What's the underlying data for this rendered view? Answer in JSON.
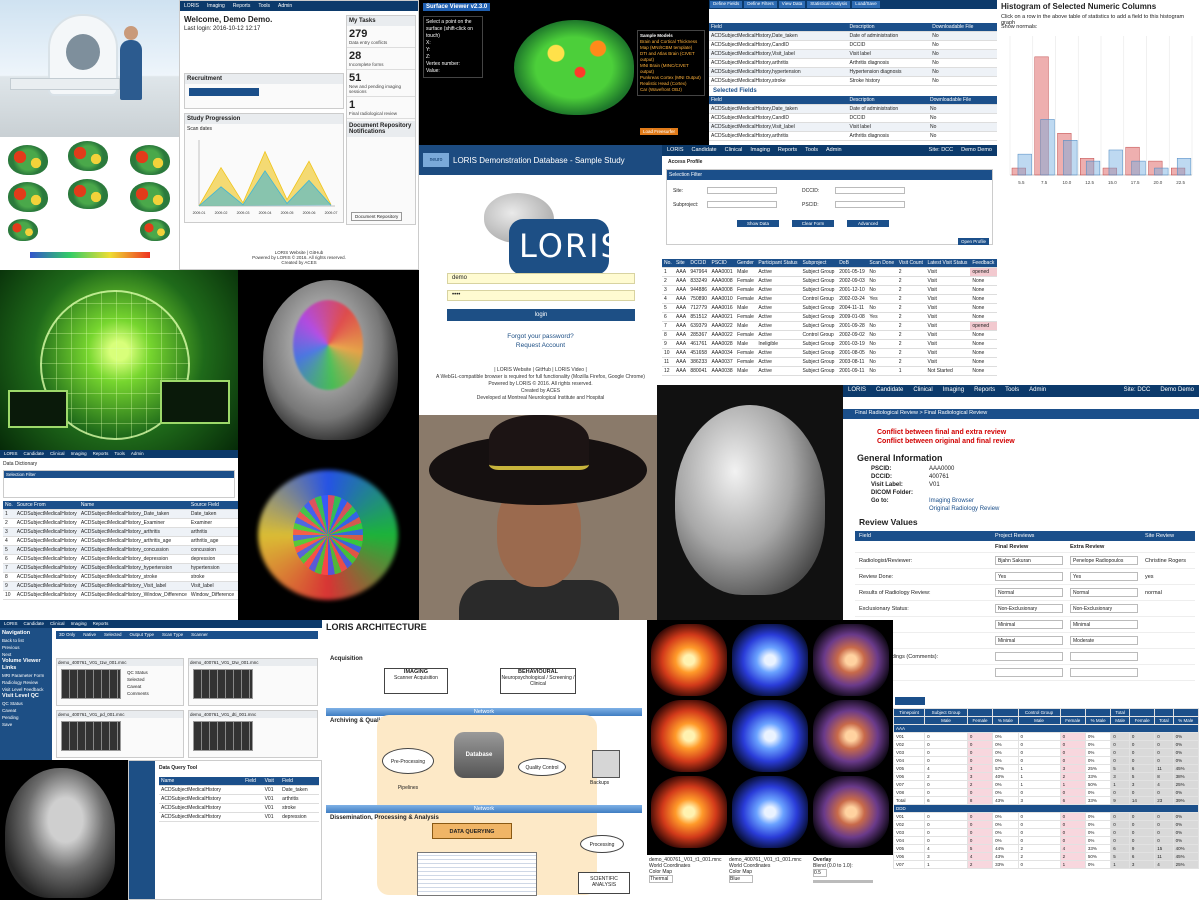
{
  "dashboard": {
    "nav": [
      "LORIS",
      "Imaging",
      "Reports",
      "Tools",
      "Admin"
    ],
    "welcome_title": "Welcome, Demo Demo.",
    "last_login": "Last login: 2016-10-12 12:17",
    "panel_recruitment": "Recruitment",
    "panel_study_progression": "Study Progression",
    "scan_dates": "Scan dates",
    "tasks_title": "My Tasks",
    "tasks": [
      {
        "count": "279",
        "label": "Data entry conflicts"
      },
      {
        "count": "28",
        "label": "Incomplete forms"
      },
      {
        "count": "51",
        "label": "New and pending imaging sessions"
      },
      {
        "count": "1",
        "label": "Final radiological review"
      }
    ],
    "doc_title": "Document Repository Notifications",
    "doc_button": "Document Repository",
    "footer_links": "LORIS Website | GitHub",
    "footer_powered": "Powered by LORIS © 2016. All rights reserved.",
    "footer_created": "Created by ACES"
  },
  "surface_viewer": {
    "title": "Surface Viewer v2.3.0",
    "prompt": "Select a point on the surface (shift-click on touch)",
    "fields": [
      "X:",
      "Y:",
      "Z:",
      "Vertex number:",
      "Value:"
    ],
    "models_title": "Sample Models",
    "models": [
      "Brain and Cortical Thickness Map (MNI/ICBM template)",
      "DTI and Atlas Brain (CIVET output)",
      "MNI Brain (MINC/CIVET output)",
      "Punkreas Cortex (MNI Output)",
      "Realistic Head (Cortex)",
      "Car (Wavefront OBJ)"
    ],
    "button": "Load Freesurfer"
  },
  "data_dictionary": {
    "tabs": [
      "Define Fields",
      "Define Filters",
      "View Data",
      "Statistical Analysis",
      "Load/Save"
    ],
    "selected_fields_title": "Selected Fields",
    "columns": [
      "Field",
      "Description",
      "Downloadable File"
    ],
    "rows": [
      [
        "ACDSubjectMedicalHistory,Date_taken",
        "Date of administration",
        "No"
      ],
      [
        "ACDSubjectMedicalHistory,CandID",
        "DCCID",
        "No"
      ],
      [
        "ACDSubjectMedicalHistory,Visit_label",
        "Visit label",
        "No"
      ],
      [
        "ACDSubjectMedicalHistory,arthritis",
        "Arthritis diagnosis",
        "No"
      ],
      [
        "ACDSubjectMedicalHistory,hypertension",
        "Hypertension diagnosis",
        "No"
      ],
      [
        "ACDSubjectMedicalHistory,stroke",
        "Stroke history",
        "No"
      ]
    ]
  },
  "histogram": {
    "title": "Histogram of Selected Numeric Columns",
    "subtitle": "Click on a row in the above table of statistics to add a field to this histogram graph",
    "show_normals": "Show normals:"
  },
  "chart_data": [
    {
      "type": "line",
      "x": [
        "2009-01",
        "2009-02",
        "2009-03",
        "2009-04",
        "2009-05",
        "2009-06",
        "2009-07"
      ],
      "series": [
        {
          "values": [
            0,
            60,
            5,
            85,
            10,
            70,
            2
          ]
        },
        {
          "values": [
            0,
            30,
            2,
            55,
            4,
            40,
            1
          ]
        }
      ]
    },
    {
      "type": "bar",
      "categories": [
        "5.5",
        "7.5",
        "10.0",
        "12.5",
        "15.0",
        "17.5",
        "20.0",
        "22.5"
      ],
      "series": [
        {
          "values": [
            0.05,
            0.85,
            0.3,
            0.12,
            0.05,
            0.2,
            0.1,
            0.05
          ]
        },
        {
          "values": [
            0.15,
            0.4,
            0.25,
            0.1,
            0.18,
            0.1,
            0.05,
            0.12
          ]
        }
      ]
    }
  ],
  "login": {
    "banner": "LORIS Demonstration Database - Sample Study",
    "logo_text": "LORIS",
    "neuro": "neuro",
    "username_value": "demo",
    "password_value": "••••",
    "login_button": "login",
    "forgot": "Forgot your password?",
    "request": "Request Account",
    "links": "| LORIS Website | GitHub | LORIS Video |",
    "webgl_note": "A WebGL-compatible browser is required for full functionality (Mozilla Firefox, Google Chrome)",
    "powered": "Powered by LORIS © 2016. All rights reserved.",
    "created": "Created by ACES",
    "developed": "Developed at Montreal Neurological Institute and Hospital"
  },
  "candidate_list": {
    "nav": [
      "LORIS",
      "Candidate",
      "Clinical",
      "Imaging",
      "Reports",
      "Tools",
      "Admin"
    ],
    "site": "Site: DCC",
    "user": "Demo Demo",
    "title": "Access Profile",
    "filter_title": "Selection Filter",
    "filter_labels": [
      "Site:",
      "Subproject:",
      "DCCID:",
      "PSCID:"
    ],
    "buttons": [
      "Show Data",
      "Clear Form",
      "Advanced"
    ],
    "open_profile": "Open Profile",
    "columns": [
      "No.",
      "Site",
      "DCCID",
      "PSCID",
      "Gender",
      "Participant Status",
      "Subproject",
      "DoB",
      "Scan Done",
      "Visit Count",
      "Latest Visit Status",
      "Feedback"
    ],
    "rows": [
      [
        "1",
        "AAA",
        "947964",
        "AAA0001",
        "Male",
        "Active",
        "Subject Group",
        "2001-05-19",
        "No",
        "2",
        "Visit",
        "opened"
      ],
      [
        "2",
        "AAA",
        "833249",
        "AAA0008",
        "Female",
        "Active",
        "Subject Group",
        "2002-09-03",
        "No",
        "2",
        "Visit",
        "None"
      ],
      [
        "3",
        "AAA",
        "944886",
        "AAA0008",
        "Female",
        "Active",
        "Subject Group",
        "2001-12-10",
        "No",
        "2",
        "Visit",
        "None"
      ],
      [
        "4",
        "AAA",
        "750890",
        "AAA0010",
        "Female",
        "Active",
        "Control Group",
        "2002-03-24",
        "Yes",
        "2",
        "Visit",
        "None"
      ],
      [
        "5",
        "AAA",
        "712779",
        "AAA0016",
        "Male",
        "Active",
        "Subject Group",
        "2004-11-11",
        "No",
        "2",
        "Visit",
        "None"
      ],
      [
        "6",
        "AAA",
        "851512",
        "AAA0021",
        "Female",
        "Active",
        "Subject Group",
        "2009-01-08",
        "Yes",
        "2",
        "Visit",
        "None"
      ],
      [
        "7",
        "AAA",
        "639379",
        "AAA0022",
        "Male",
        "Active",
        "Subject Group",
        "2001-09-28",
        "No",
        "2",
        "Visit",
        "opened"
      ],
      [
        "8",
        "AAA",
        "285367",
        "AAA0022",
        "Female",
        "Active",
        "Control Group",
        "2002-09-02",
        "No",
        "2",
        "Visit",
        "None"
      ],
      [
        "9",
        "AAA",
        "461761",
        "AAA0028",
        "Male",
        "Ineligible",
        "Subject Group",
        "2001-03-19",
        "No",
        "2",
        "Visit",
        "None"
      ],
      [
        "10",
        "AAA",
        "451658",
        "AAA0034",
        "Female",
        "Active",
        "Subject Group",
        "2001-08-05",
        "No",
        "2",
        "Visit",
        "None"
      ],
      [
        "11",
        "AAA",
        "386233",
        "AAA0037",
        "Female",
        "Active",
        "Subject Group",
        "2003-08-11",
        "No",
        "2",
        "Visit",
        "None"
      ],
      [
        "12",
        "AAA",
        "880041",
        "AAA0038",
        "Male",
        "Active",
        "Subject Group",
        "2001-09-11",
        "No",
        "1",
        "Not Started",
        "None"
      ]
    ]
  },
  "radiology": {
    "nav": [
      "LORIS",
      "Candidate",
      "Clinical",
      "Imaging",
      "Reports",
      "Tools",
      "Admin"
    ],
    "site": "Site: DCC",
    "user": "Demo Demo",
    "breadcrumb": "Final Radiological Review > Final Radiological Review",
    "conflict1": "Conflict between final and extra review",
    "conflict2": "Conflict between original and final review",
    "general_title": "General Information",
    "info": [
      {
        "k": "PSCID:",
        "v": "AAA0000"
      },
      {
        "k": "DCCID:",
        "v": "400761"
      },
      {
        "k": "Visit Label:",
        "v": "V01"
      },
      {
        "k": "DICOM Folder:",
        "v": ""
      },
      {
        "k": "Go to:",
        "v": "Imaging Browser"
      },
      {
        "k": "",
        "v": "Original Radiology Review"
      }
    ],
    "review_title": "Review Values",
    "headers": [
      "Field",
      "Project Reviews",
      "Site Review"
    ],
    "subheaders": [
      "Final Review",
      "Extra Review"
    ],
    "rows": [
      {
        "field": "Radiologist/Reviewer:",
        "final": "Bjahn Sakuran",
        "extra": "Penelope Radiopoulos",
        "site": "Christine Rogers"
      },
      {
        "field": "Review Done:",
        "final": "Yes",
        "extra": "Yes",
        "site": "yes"
      },
      {
        "field": "Results of Radiology Review:",
        "final": "Normal",
        "extra": "Normal",
        "site": "normal"
      },
      {
        "field": "Exclusionary Status:",
        "final": "Non-Exclusionary",
        "extra": "Non-Exclusionary",
        "site": ""
      },
      {
        "field": "",
        "final": "Minimal",
        "extra": "Minimal",
        "site": ""
      },
      {
        "field": "",
        "final": "Minimal",
        "extra": "Moderate",
        "site": ""
      },
      {
        "field": "Incidental Findings (Comments):",
        "final": "",
        "extra": "",
        "site": ""
      },
      {
        "field": "Lead?",
        "final": "",
        "extra": "",
        "site": ""
      }
    ]
  },
  "stats": {
    "headers": [
      "Timepoint",
      "Subject Group",
      "",
      "",
      "Control Group",
      "",
      "",
      "Total",
      "",
      "",
      ""
    ],
    "sub": [
      "",
      "Male",
      "Female",
      "% Male",
      "Male",
      "Female",
      "% Male",
      "Male",
      "Female",
      "Total",
      "% Male"
    ],
    "sections": [
      {
        "name": "AAA",
        "rows": [
          [
            "V01",
            "0",
            "0",
            "0%",
            "0",
            "0",
            "0%",
            "0",
            "0",
            "0",
            "0%"
          ],
          [
            "V02",
            "0",
            "0",
            "0%",
            "0",
            "0",
            "0%",
            "0",
            "0",
            "0",
            "0%"
          ],
          [
            "V03",
            "0",
            "0",
            "0%",
            "0",
            "0",
            "0%",
            "0",
            "0",
            "0",
            "0%"
          ],
          [
            "V04",
            "0",
            "0",
            "0%",
            "0",
            "0",
            "0%",
            "0",
            "0",
            "0",
            "0%"
          ],
          [
            "V05",
            "4",
            "3",
            "57%",
            "1",
            "3",
            "25%",
            "5",
            "6",
            "11",
            "45%"
          ],
          [
            "V06",
            "2",
            "3",
            "40%",
            "1",
            "2",
            "33%",
            "3",
            "5",
            "8",
            "38%"
          ],
          [
            "V07",
            "0",
            "2",
            "0%",
            "1",
            "1",
            "50%",
            "1",
            "3",
            "4",
            "25%"
          ],
          [
            "V08",
            "0",
            "0",
            "0%",
            "0",
            "0",
            "0%",
            "0",
            "0",
            "0",
            "0%"
          ],
          [
            "Total",
            "6",
            "8",
            "43%",
            "3",
            "6",
            "33%",
            "9",
            "14",
            "23",
            "39%"
          ]
        ]
      },
      {
        "name": "DDD",
        "rows": [
          [
            "V01",
            "0",
            "0",
            "0%",
            "0",
            "0",
            "0%",
            "0",
            "0",
            "0",
            "0%"
          ],
          [
            "V02",
            "0",
            "0",
            "0%",
            "0",
            "0",
            "0%",
            "0",
            "0",
            "0",
            "0%"
          ],
          [
            "V03",
            "0",
            "0",
            "0%",
            "0",
            "0",
            "0%",
            "0",
            "0",
            "0",
            "0%"
          ],
          [
            "V04",
            "0",
            "0",
            "0%",
            "0",
            "0",
            "0%",
            "0",
            "0",
            "0",
            "0%"
          ],
          [
            "V05",
            "4",
            "5",
            "44%",
            "2",
            "4",
            "33%",
            "6",
            "9",
            "15",
            "40%"
          ],
          [
            "V06",
            "3",
            "4",
            "43%",
            "2",
            "2",
            "50%",
            "5",
            "6",
            "11",
            "45%"
          ],
          [
            "V07",
            "1",
            "2",
            "33%",
            "0",
            "1",
            "0%",
            "1",
            "3",
            "4",
            "25%"
          ]
        ]
      }
    ]
  },
  "list_panel": {
    "nav": [
      "LORIS",
      "Candidate",
      "Clinical",
      "Imaging",
      "Reports",
      "Tools",
      "Admin"
    ],
    "title": "Data Dictionary",
    "filter": "Selection Filter",
    "columns": [
      "No.",
      "Source From",
      "Name",
      "Source Field",
      "Description"
    ],
    "rows": [
      [
        "1",
        "ACDSubjectMedicalHistory",
        "ACDSubjectMedicalHistory_Date_taken",
        "Date_taken",
        "Date of administration"
      ],
      [
        "2",
        "ACDSubjectMedicalHistory",
        "ACDSubjectMedicalHistory_Examiner",
        "Examiner",
        "Examiner"
      ],
      [
        "3",
        "ACDSubjectMedicalHistory",
        "ACDSubjectMedicalHistory_arthritis",
        "arthritis",
        "Arthritis diagnosis"
      ],
      [
        "4",
        "ACDSubjectMedicalHistory",
        "ACDSubjectMedicalHistory_arthritis_age",
        "arthritis_age",
        "Age of arthritis diagnosis"
      ],
      [
        "5",
        "ACDSubjectMedicalHistory",
        "ACDSubjectMedicalHistory_concussion",
        "concussion",
        "Concussion history"
      ],
      [
        "6",
        "ACDSubjectMedicalHistory",
        "ACDSubjectMedicalHistory_depression",
        "depression",
        "Depression history"
      ],
      [
        "7",
        "ACDSubjectMedicalHistory",
        "ACDSubjectMedicalHistory_hypertension",
        "hypertension",
        "Hypertension diagnosis"
      ],
      [
        "8",
        "ACDSubjectMedicalHistory",
        "ACDSubjectMedicalHistory_stroke",
        "stroke",
        "Stroke history"
      ],
      [
        "9",
        "ACDSubjectMedicalHistory",
        "ACDSubjectMedicalHistory_Visit_label",
        "Visit_label",
        "Visit label"
      ],
      [
        "10",
        "ACDSubjectMedicalHistory",
        "ACDSubjectMedicalHistory_Window_Difference",
        "Window_Difference",
        "Window difference"
      ]
    ]
  },
  "qc": {
    "sidebar_title": "Navigation",
    "sidebar_links": [
      "Back to list",
      "Previous",
      "Next"
    ],
    "viewer_title": "Volume Viewer",
    "links_title": "Links",
    "link_items": [
      "MRI Parameter Form",
      "Radiology Review",
      "Visit Level Feedback"
    ],
    "visit_qc_title": "Visit Level QC",
    "qc_labels": [
      "QC Status",
      "Caveat",
      "Pending",
      "Save"
    ],
    "tabs": [
      "3D Only",
      "Native",
      "Selected",
      "Output Type",
      "Scan Type",
      "Scanner"
    ],
    "scans": [
      "demo_400761_V01_t1w_001.mnc",
      "demo_400761_V01_t2w_001.mnc",
      "demo_400761_V01_pd_001.mnc",
      "demo_400761_V01_dti_001.mnc"
    ],
    "scan_fields": [
      "QC Status",
      "Selected",
      "Caveat",
      "Comments"
    ]
  },
  "architecture": {
    "title": "LORIS ARCHITECTURE",
    "acquisition": "Acquisition",
    "archiving": "Archiving & Quality Control",
    "dissemination": "Dissemination, Processing & Analysis",
    "network": "Network",
    "imaging_box": {
      "title": "IMAGING",
      "sub": "Scanner Acquisition"
    },
    "behavioural_box": {
      "title": "BEHAVIOURAL",
      "sub": "Neuropsychological / Screening / Clinical"
    },
    "preprocessing": "Pre-Processing Pipelines",
    "database": "Database",
    "quality_control": "Quality Control",
    "backups": "Backups",
    "data_querying": "DATA QUERYING",
    "processing": "Processing",
    "scientific": "SCIENTIFIC ANALYSIS"
  },
  "ortho": {
    "files": [
      "demo_400761_V01_t1_001.mnc",
      "demo_400761_V01_t1_001.mnc"
    ],
    "world_coords": "World Coordinates",
    "overlay": "Overlay",
    "blend": "Blend (0.0 to 1.0):",
    "blend_value": "0.5",
    "color_map": "Color Map",
    "color_map_values": [
      "Thermal",
      "Blue"
    ]
  },
  "dataquery": {
    "header": "Data Query Tool",
    "columns": [
      "Name",
      "Field",
      "Visit",
      "Field"
    ],
    "rows": [
      [
        "ACDSubjectMedicalHistory",
        "",
        "V01",
        "Date_taken"
      ],
      [
        "ACDSubjectMedicalHistory",
        "",
        "V01",
        "arthritis"
      ],
      [
        "ACDSubjectMedicalHistory",
        "",
        "V01",
        "stroke"
      ],
      [
        "ACDSubjectMedicalHistory",
        "",
        "V01",
        "depression"
      ]
    ]
  }
}
